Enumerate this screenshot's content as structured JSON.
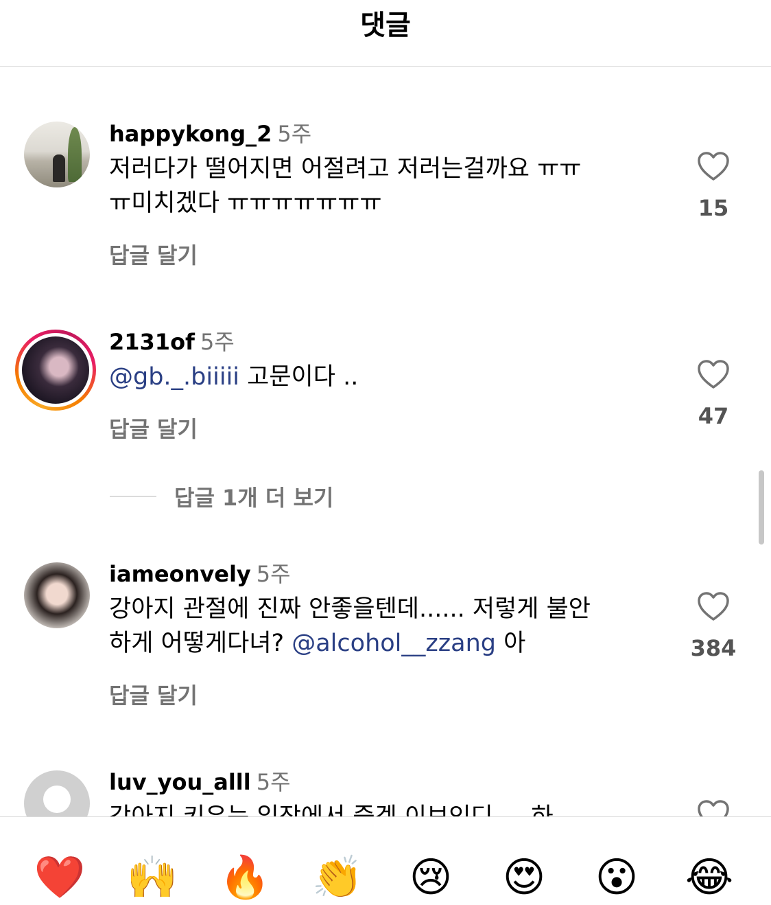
{
  "header": {
    "title": "댓글"
  },
  "comments": [
    {
      "username": "happykong_2",
      "time": "5주",
      "text_line1": "저러다가 떨어지면 어절려고 저러는걸까요 ㅠㅠ",
      "text_line2": "ㅠ미치겠다 ㅠㅠㅠㅠㅠㅠㅠ",
      "reply_label": "답글 달기",
      "likes": "15"
    },
    {
      "username": "2131of",
      "time": "5주",
      "mention": "@gb._.biiiii",
      "text": " 고문이다 ..",
      "reply_label": "답글 달기",
      "likes": "47",
      "view_replies": "답글 1개 더 보기"
    },
    {
      "username": "iameonvely",
      "time": "5주",
      "text_line1": "강아지 관절에 진짜 안좋을텐데...... 저렇게 불안",
      "text_line2_prefix": "하게 어떻게다녀? ",
      "mention": "@alcohol__zzang",
      "text_line2_suffix": " 아",
      "reply_label": "답글 달기",
      "likes": "384"
    },
    {
      "username": "luv_you_alll",
      "time": "5주",
      "text_partial": "강아지 키우는 입장에서 죽겠 이브인디 ... 하"
    }
  ],
  "reactions": [
    {
      "icon": "heart",
      "glyph": "❤️"
    },
    {
      "icon": "raising-hands",
      "glyph": "🙌"
    },
    {
      "icon": "fire",
      "glyph": "🔥"
    },
    {
      "icon": "clapping-hands",
      "glyph": "👏"
    },
    {
      "icon": "crying-face",
      "glyph": "😢"
    },
    {
      "icon": "heart-eyes",
      "glyph": "😍"
    },
    {
      "icon": "surprised-face",
      "glyph": "😮"
    },
    {
      "icon": "tears-of-joy",
      "glyph": "😂"
    }
  ]
}
